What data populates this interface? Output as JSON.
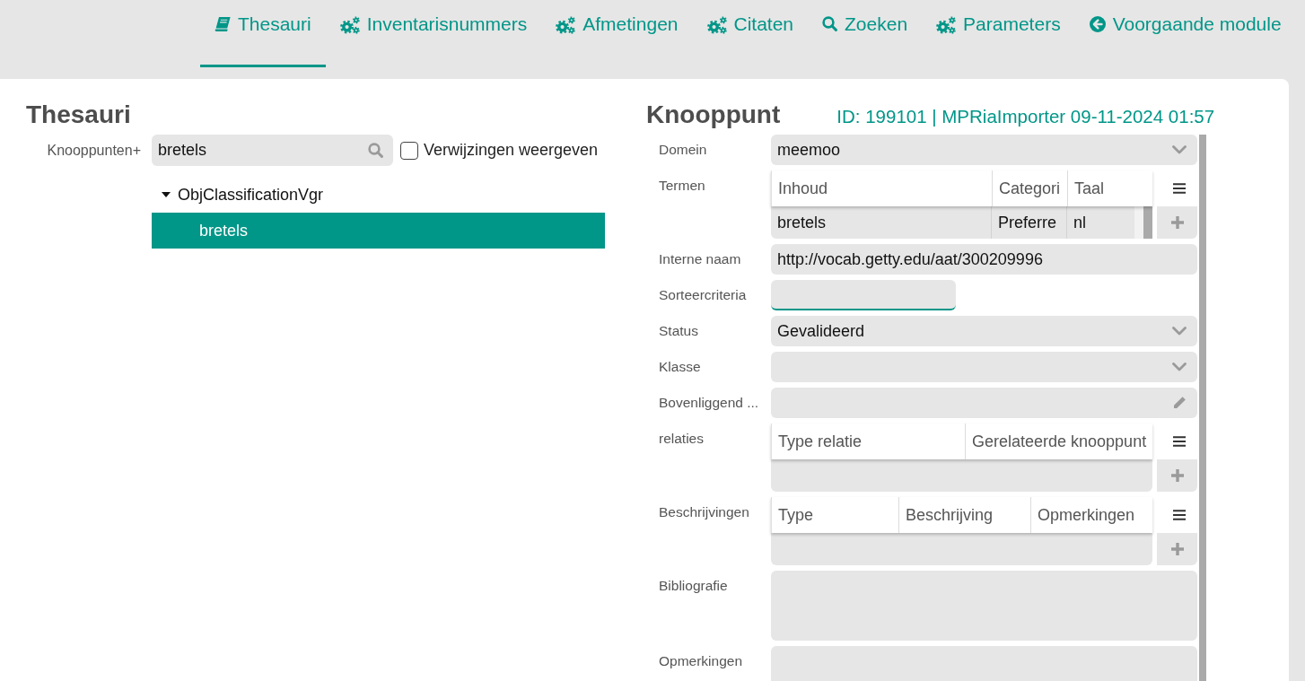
{
  "nav": [
    {
      "kind": "book",
      "label": "Thesauri",
      "selected": true
    },
    {
      "kind": "gears",
      "label": "Inventarisnummers",
      "selected": false
    },
    {
      "kind": "gears",
      "label": "Afmetingen",
      "selected": false
    },
    {
      "kind": "gears",
      "label": "Citaten",
      "selected": false
    },
    {
      "kind": "search",
      "label": "Zoeken",
      "selected": false
    },
    {
      "kind": "gears",
      "label": "Parameters",
      "selected": false
    },
    {
      "kind": "back",
      "label": "Voorgaande module",
      "selected": false
    }
  ],
  "thesauri_panel": {
    "title": "Thesauri",
    "search": {
      "label": "Knooppunten+",
      "value": "bretels"
    },
    "show_references": {
      "label": "Verwijzingen weergeven",
      "checked": false
    },
    "tree": [
      {
        "label": "ObjClassificationVgr",
        "expanded": true,
        "selected": false,
        "children": [
          {
            "label": "bretels",
            "selected": true
          }
        ]
      }
    ]
  },
  "node_panel": {
    "title": "Knooppunt",
    "meta": "ID: 199101 | MPRiaImporter 09-11-2024 01:57",
    "fields": [
      {
        "kind": "select",
        "label": "Domein",
        "value": "meemoo",
        "focused": false
      },
      {
        "kind": "grid",
        "label": "Termen",
        "columns": [
          "Inhoud",
          "Categori",
          "Taal"
        ],
        "rows": [
          [
            "bretels",
            "Preferre",
            "nl"
          ]
        ],
        "focused": false
      },
      {
        "kind": "text",
        "label": "Interne naam",
        "value": "http://vocab.getty.edu/aat/300209996",
        "focused": false
      },
      {
        "kind": "short_text",
        "label": "Sorteercriteria",
        "focused": true
      },
      {
        "kind": "select",
        "label": "Status",
        "value": "Gevalideerd",
        "focused": false
      },
      {
        "kind": "select",
        "label": "Klasse",
        "focused": false
      },
      {
        "kind": "lookup",
        "label": "Bovenliggend ...",
        "focused": false
      },
      {
        "kind": "grid",
        "label": "relaties",
        "columns": [
          "Type relatie",
          "Gerelateerde knooppunt"
        ],
        "focused": false
      },
      {
        "kind": "grid",
        "label": "Beschrijvingen",
        "columns": [
          "Type",
          "Beschrijving",
          "Opmerkingen"
        ],
        "focused": false
      },
      {
        "kind": "textarea",
        "label": "Bibliografie",
        "focused": false
      },
      {
        "kind": "textarea",
        "label": "Opmerkingen"
      }
    ]
  }
}
